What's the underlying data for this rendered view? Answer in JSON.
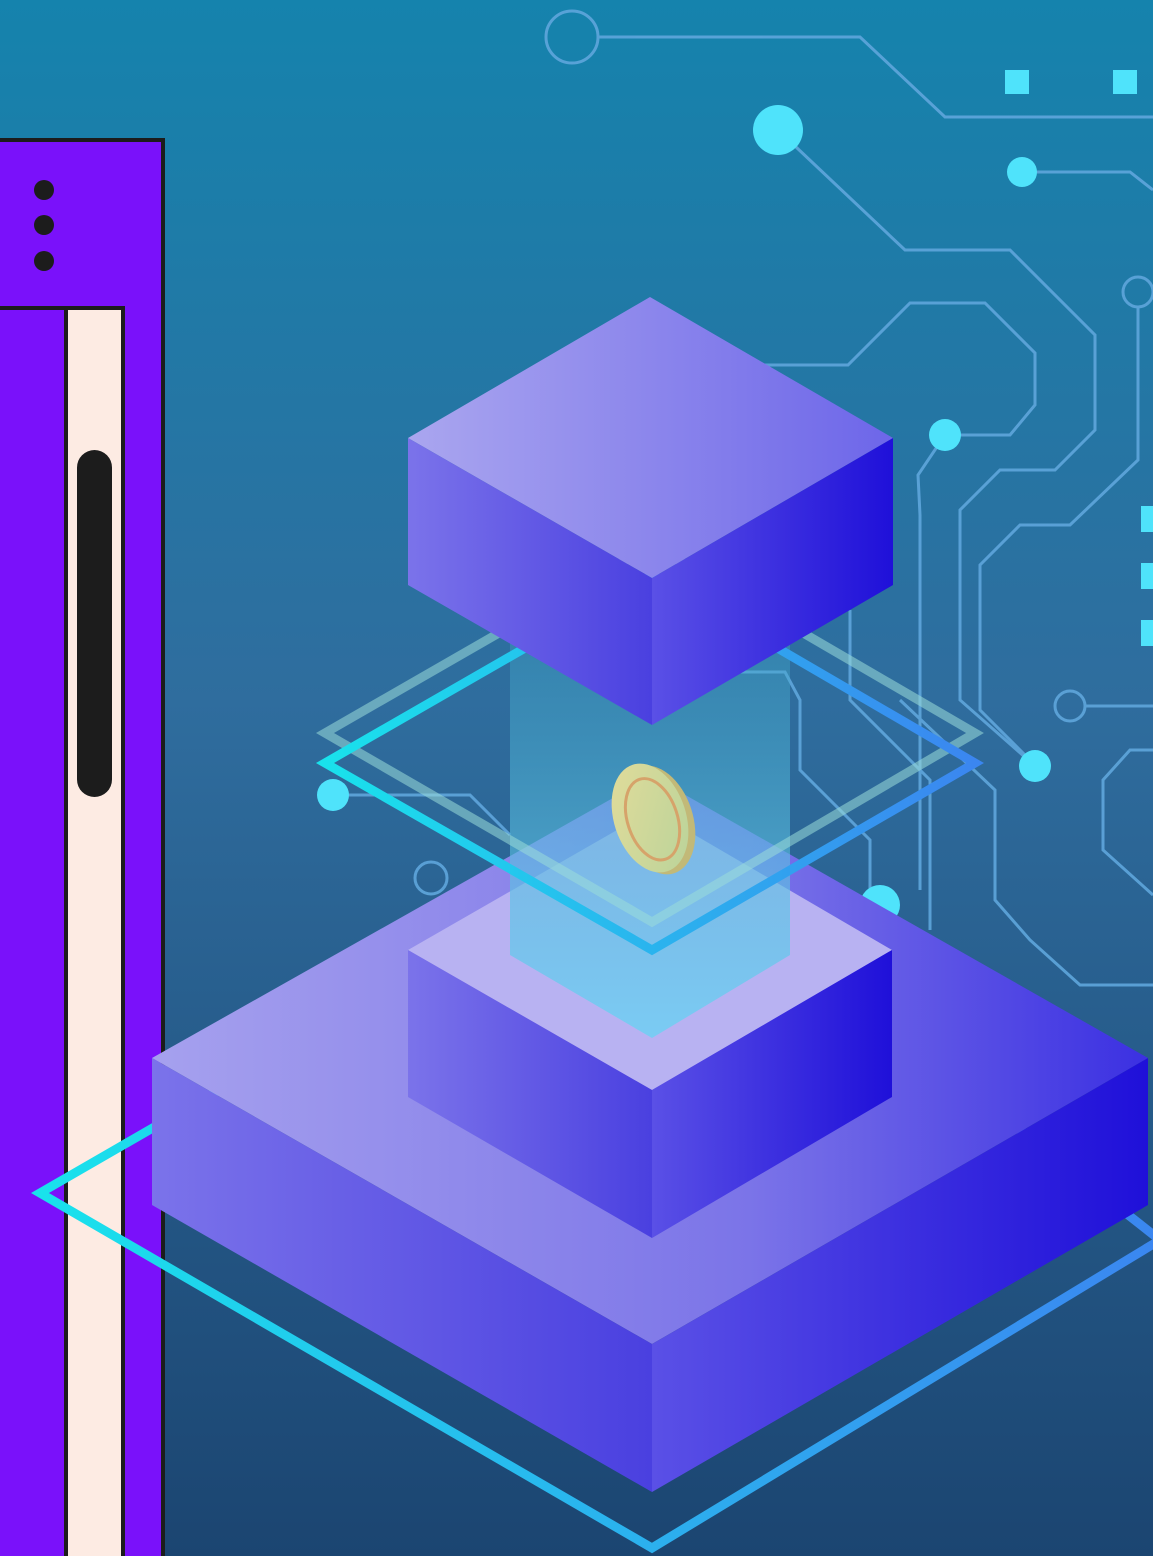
{
  "colors": {
    "background_top": "#1583ad",
    "background_bottom": "#1b4571",
    "circuit_line": "#5fa6dc",
    "circuit_node": "#4fe3fb",
    "panel_purple": "#7a11fa",
    "panel_cream": "#fdebe3",
    "outline_dark": "#1c1c1c",
    "neon_cyan": "#19e2ec",
    "neon_blue": "#3b86f0",
    "cube_light": "#a7a2f0",
    "cube_mid": "#6a63e6",
    "cube_dark": "#2212dc",
    "coin": "#d8d48f"
  },
  "icons": {
    "menu": "kebab-menu-icon",
    "coin": "coin-icon"
  }
}
